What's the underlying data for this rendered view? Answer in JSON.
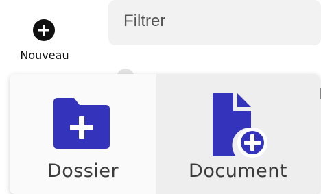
{
  "new_button": {
    "label": "Nouveau",
    "icon": "plus-circle-icon"
  },
  "filter": {
    "placeholder": "Filtrer"
  },
  "menu": {
    "accent_color": "#3333bb",
    "items": [
      {
        "label": "Dossier",
        "icon": "folder-plus-icon"
      },
      {
        "label": "Document",
        "icon": "file-plus-icon"
      }
    ]
  }
}
